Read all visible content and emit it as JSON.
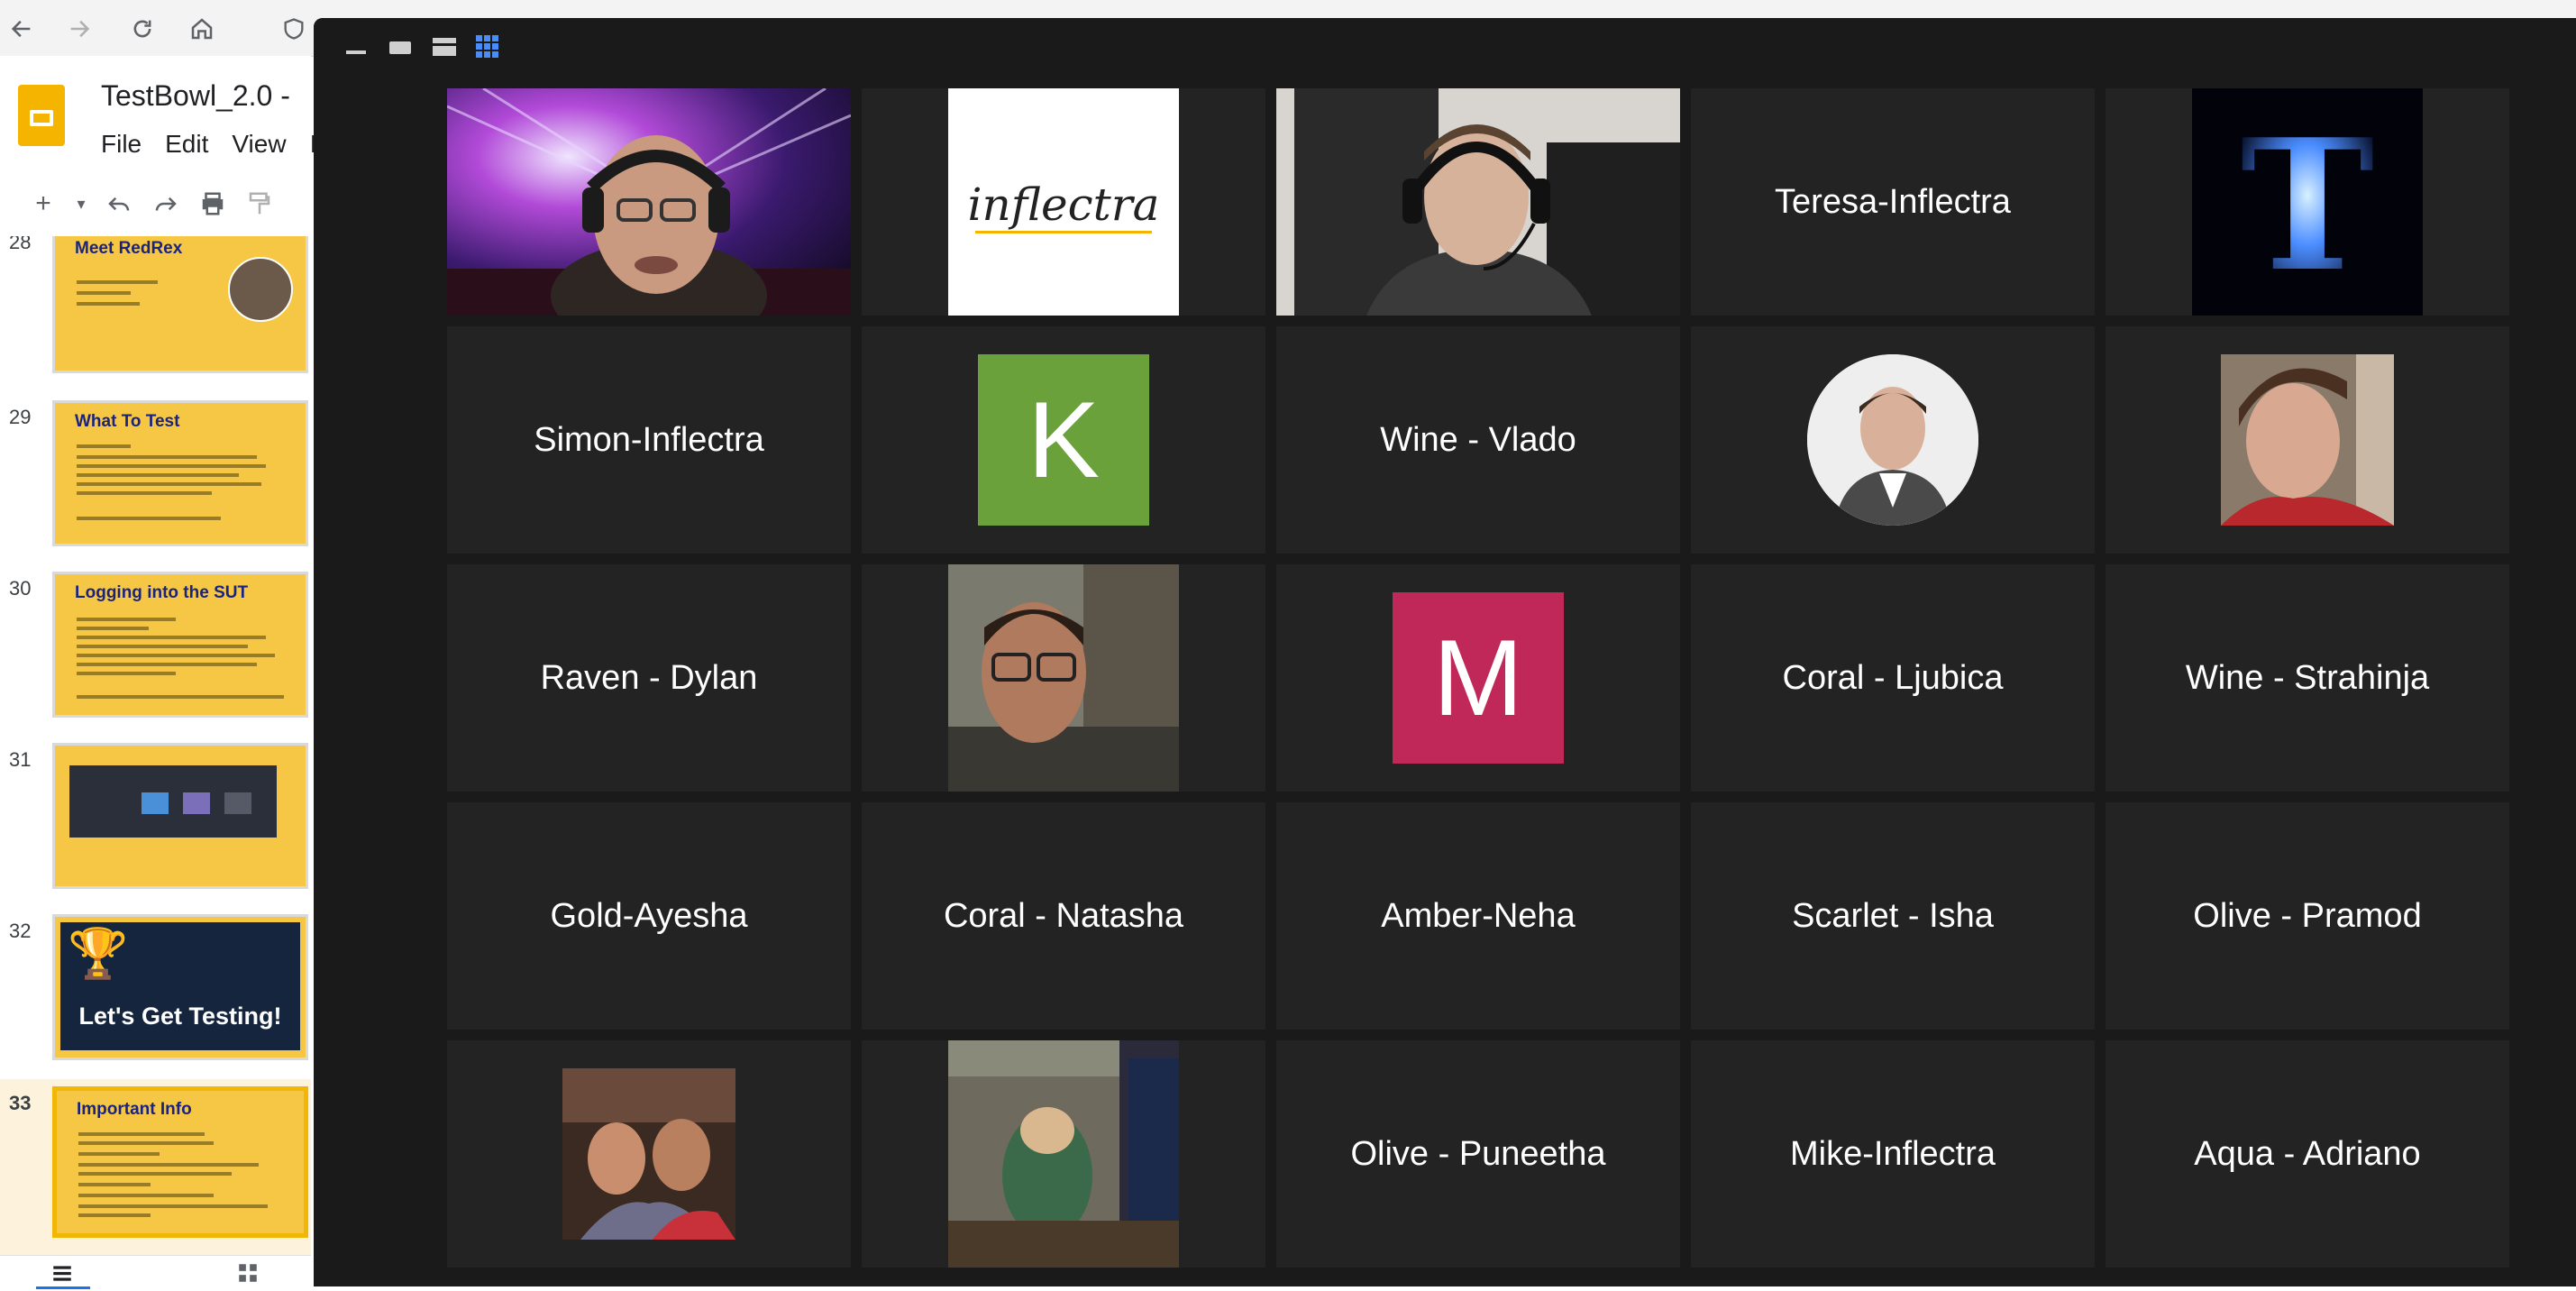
{
  "app": {
    "doc_title": "TestBowl_2.0 -",
    "menu": [
      "File",
      "Edit",
      "View",
      "I"
    ],
    "slides": [
      {
        "num": "28",
        "title": "Meet RedRex"
      },
      {
        "num": "29",
        "title": "What To Test"
      },
      {
        "num": "30",
        "title": "Logging into the SUT"
      },
      {
        "num": "31",
        "title": ""
      },
      {
        "num": "32",
        "title": "Let's Get Testing!"
      },
      {
        "num": "33",
        "title": "Important Info"
      }
    ]
  },
  "zoom": {
    "participants": [
      {
        "name": "",
        "kind": "video-host"
      },
      {
        "name": "",
        "kind": "logo",
        "logo_text": "inflectra"
      },
      {
        "name": "",
        "kind": "video-headset"
      },
      {
        "name": "Teresa-Inflectra",
        "kind": "name"
      },
      {
        "name": "",
        "kind": "avatar-t"
      },
      {
        "name": "Simon-Inflectra",
        "kind": "name"
      },
      {
        "name": "",
        "kind": "initial",
        "initial": "K",
        "color": "#6aa13b"
      },
      {
        "name": "Wine - Vlado",
        "kind": "name"
      },
      {
        "name": "",
        "kind": "avatar-round"
      },
      {
        "name": "",
        "kind": "avatar-photo"
      },
      {
        "name": "Raven - Dylan",
        "kind": "name"
      },
      {
        "name": "",
        "kind": "avatar-glasses"
      },
      {
        "name": "",
        "kind": "initial",
        "initial": "M",
        "color": "#c1285a"
      },
      {
        "name": "Coral - Ljubica",
        "kind": "name"
      },
      {
        "name": "Wine - Strahinja",
        "kind": "name"
      },
      {
        "name": "Gold-Ayesha",
        "kind": "name"
      },
      {
        "name": "Coral - Natasha",
        "kind": "name"
      },
      {
        "name": "Amber-Neha",
        "kind": "name"
      },
      {
        "name": "Scarlet - Isha",
        "kind": "name"
      },
      {
        "name": "Olive - Pramod",
        "kind": "name"
      },
      {
        "name": "",
        "kind": "avatar-couple"
      },
      {
        "name": "",
        "kind": "avatar-store"
      },
      {
        "name": "Olive - Puneetha",
        "kind": "name"
      },
      {
        "name": "Mike-Inflectra",
        "kind": "name"
      },
      {
        "name": "Aqua - Adriano",
        "kind": "name"
      }
    ]
  }
}
